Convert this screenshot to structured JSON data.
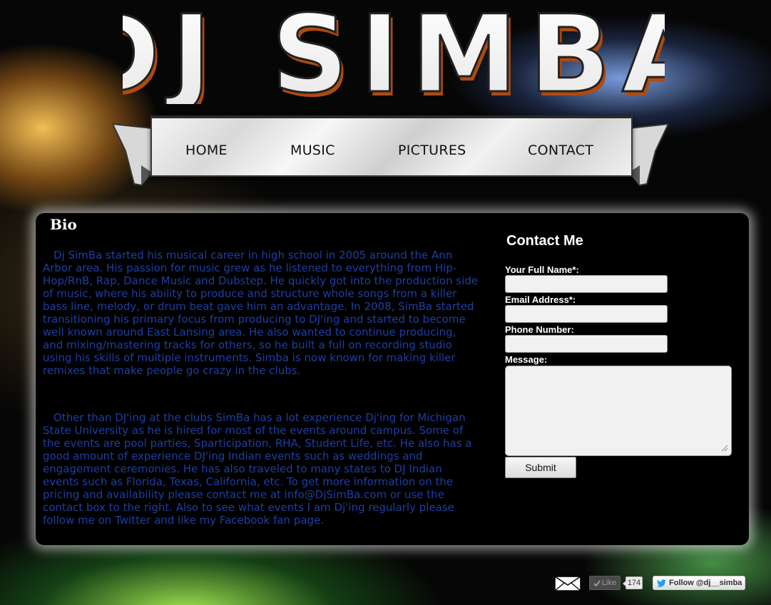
{
  "site": {
    "logo_text": "DJ SIMBA"
  },
  "nav": {
    "items": [
      {
        "label": "HOME"
      },
      {
        "label": "MUSIC"
      },
      {
        "label": "PICTURES"
      },
      {
        "label": "CONTACT"
      }
    ]
  },
  "bio": {
    "heading": "Bio",
    "paragraphs": [
      "Dj SimBa started his musical career in high school in 2005 around the Ann Arbor area. His passion for music grew as he listened to everything from Hip-Hop/RnB, Rap, Dance Music and Dubstep. He quickly got into the production side of music, where his ability to produce and structure whole songs from a killer bass line, melody, or drum beat gave him an advantage. In 2008, SimBa started transitioning his primary focus from producing to DJ'ing and started to become well known around East Lansing area. He also wanted to continue producing, and mixing/mastering tracks for others, so he built a full on recording studio using his skills of multiple instruments. Simba is now known for making killer remixes that make people go crazy in the clubs.",
      "Other than DJ'ing at the clubs SimBa has a lot experience Dj'ing for Michigan State University as he is hired for most of the events around campus. Some of the events are pool parties, Sparticipation, RHA, Student Life, etc. He also has a good amount of experience DJ'ing Indian events such as weddings and engagement ceremonies. He has also traveled to many states to DJ Indian events such as Florida, Texas, California, etc. To get more information on the pricing and availability please contact me at info@DjSimBa.com or use the contact box to the right. Also to see what events I am Dj'ing regularly please follow me on Twitter and like my Facebook fan page."
    ]
  },
  "contact": {
    "heading": "Contact Me",
    "name_label": "Your Full Name*:",
    "name_value": "",
    "email_label": "Email Address*:",
    "email_value": "",
    "phone_label": "Phone Number:",
    "phone_value": "",
    "message_label": "Message:",
    "message_value": "",
    "submit_label": "Submit"
  },
  "social": {
    "mail_icon": "envelope-icon",
    "like_label": "Like",
    "like_count": "174",
    "follow_label": "Follow @dj__simba"
  },
  "colors": {
    "bio_text": "#1d3fa0",
    "panel_bg": "#000000",
    "nav_text": "#111111",
    "twitter_blue": "#1da1f2"
  }
}
